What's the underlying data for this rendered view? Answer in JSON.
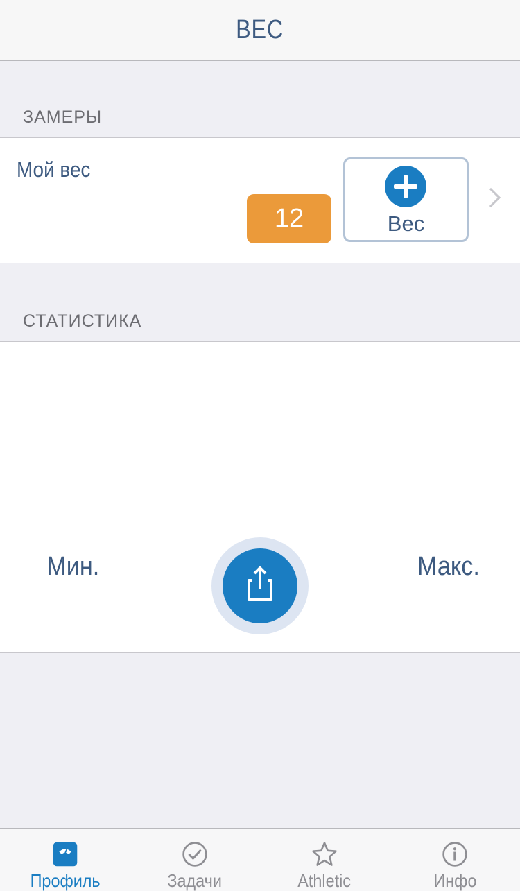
{
  "navbar": {
    "title": "ВЕС"
  },
  "measurements": {
    "header": "ЗАМЕРЫ",
    "weight_label": "Мой вес",
    "count_badge": "12",
    "add_button_label": "Вес"
  },
  "statistics": {
    "header": "СТАТИСТИКА",
    "min_label": "Мин.",
    "max_label": "Макс."
  },
  "tabbar": {
    "tabs": [
      {
        "label": "Профиль",
        "icon": "scale-icon",
        "active": true
      },
      {
        "label": "Задачи",
        "icon": "checkmark-circle-icon",
        "active": false
      },
      {
        "label": "Athletic",
        "icon": "star-icon",
        "active": false
      },
      {
        "label": "Инфо",
        "icon": "info-icon",
        "active": false
      }
    ]
  },
  "colors": {
    "accent": "#1a7dc2",
    "badge": "#eb9a3a",
    "text": "#3d5a80",
    "background": "#efeff4"
  }
}
